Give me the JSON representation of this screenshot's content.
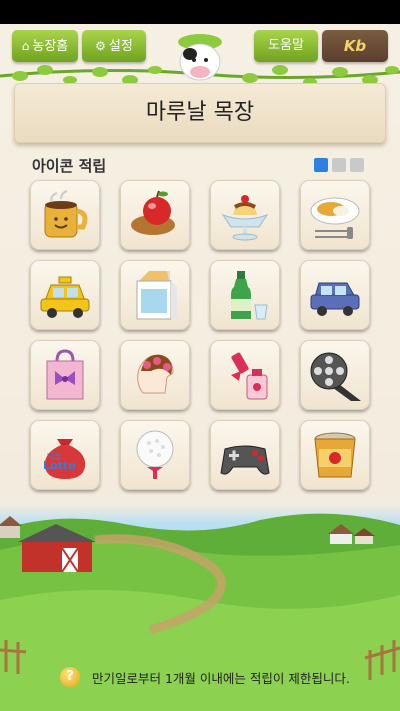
{
  "header": {
    "home_label": "농장홈",
    "settings_label": "설정",
    "help_label": "도움말",
    "brand_label": "Kb"
  },
  "board": {
    "title": "마루날 목장"
  },
  "section": {
    "title": "아이콘 적립",
    "pages_total": 3,
    "current_page": 1
  },
  "icons": [
    {
      "name": "coffee-mug-icon"
    },
    {
      "name": "apple-bread-icon"
    },
    {
      "name": "pudding-dessert-icon"
    },
    {
      "name": "meal-plate-icon"
    },
    {
      "name": "taxi-icon"
    },
    {
      "name": "milk-carton-icon"
    },
    {
      "name": "soju-bottle-icon"
    },
    {
      "name": "suv-car-icon"
    },
    {
      "name": "gift-bag-icon"
    },
    {
      "name": "hair-salon-icon"
    },
    {
      "name": "nail-polish-icon"
    },
    {
      "name": "film-reel-icon"
    },
    {
      "name": "lotto-pouch-icon",
      "text_top": "나눔",
      "text_bottom": "Lotto"
    },
    {
      "name": "golf-ball-icon"
    },
    {
      "name": "game-controller-icon"
    },
    {
      "name": "cup-noodle-icon"
    }
  ],
  "footer": {
    "notice": "만기일로부터 1개월 이내에는 적립이 제한됩니다."
  },
  "colors": {
    "nav_green": "#8cc23a",
    "brand_brown": "#6b4d36",
    "page_dot_active": "#2f7fe0"
  }
}
